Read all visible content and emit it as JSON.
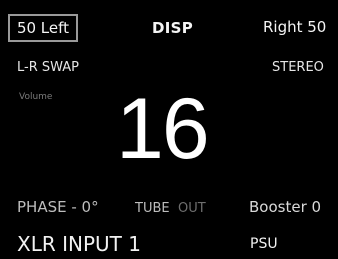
{
  "header": {
    "balance_left": "50 Left",
    "display_button": "DISP",
    "balance_right": "Right 50"
  },
  "modes": {
    "swap": "L-R SWAP",
    "output_mode": "STEREO"
  },
  "volume": {
    "label": "Volume",
    "value": "16"
  },
  "status": {
    "phase": "PHASE - 0°",
    "tube_label": "TUBE",
    "tube_state": "OUT",
    "booster": "Booster 0"
  },
  "footer": {
    "input": "XLR INPUT 1",
    "psu": "PSU"
  }
}
